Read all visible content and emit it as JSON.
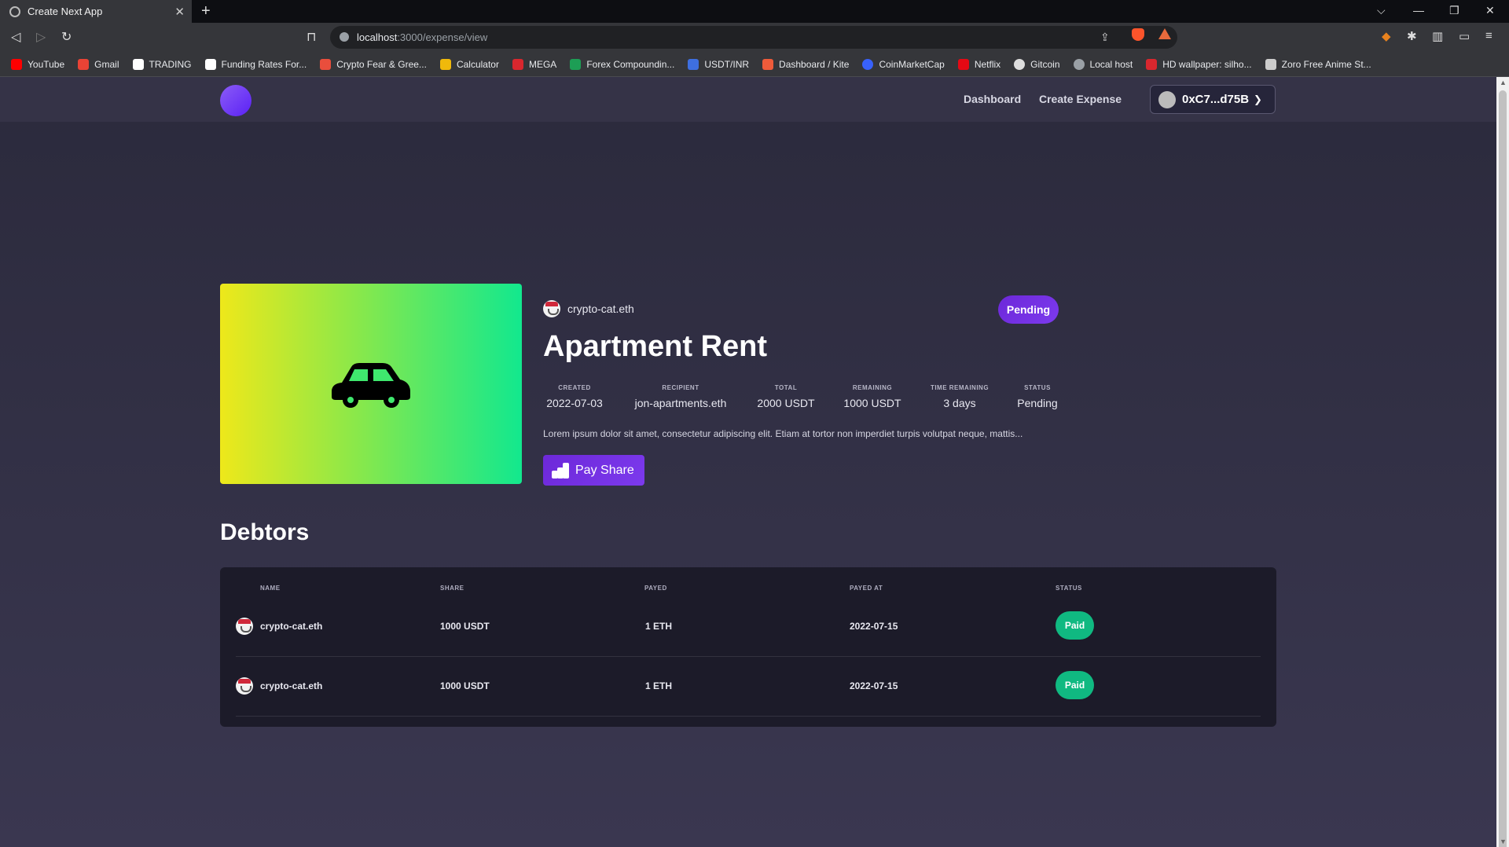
{
  "browser": {
    "tab_title": "Create Next App",
    "new_tab": "+",
    "url_host": "localhost",
    "url_path": ":3000/expense/view",
    "bookmarks": [
      {
        "label": "YouTube",
        "color": "#ff0000"
      },
      {
        "label": "Gmail",
        "color": "#ea4335"
      },
      {
        "label": "TRADING",
        "color": "#ffffff"
      },
      {
        "label": "Funding Rates For...",
        "color": "#ffffff"
      },
      {
        "label": "Crypto Fear & Gree...",
        "color": "#e94e3c"
      },
      {
        "label": "Calculator",
        "color": "#f0b90b"
      },
      {
        "label": "MEGA",
        "color": "#d9272e"
      },
      {
        "label": "Forex Compoundin...",
        "color": "#1d9e55"
      },
      {
        "label": "USDT/INR",
        "color": "#3e6fe0"
      },
      {
        "label": "Dashboard / Kite",
        "color": "#ef5b3a"
      },
      {
        "label": "CoinMarketCap",
        "color": "#3861fb"
      },
      {
        "label": "Netflix",
        "color": "#e50914"
      },
      {
        "label": "Gitcoin",
        "color": "#dddddd"
      },
      {
        "label": "Local host",
        "color": "#9aa0a6"
      },
      {
        "label": "HD wallpaper: silho...",
        "color": "#d9272e"
      },
      {
        "label": "Zoro Free Anime St...",
        "color": "#cccccc"
      }
    ]
  },
  "nav": {
    "links": [
      "Dashboard",
      "Create Expense"
    ],
    "wallet": "0xC7...d75B"
  },
  "expense": {
    "owner": "crypto-cat.eth",
    "badge": "Pending",
    "title": "Apartment Rent",
    "stats": [
      {
        "label": "CREATED",
        "value": "2022-07-03"
      },
      {
        "label": "RECIPIENT",
        "value": "jon-apartments.eth"
      },
      {
        "label": "TOTAL",
        "value": "2000 USDT"
      },
      {
        "label": "REMAINING",
        "value": "1000 USDT"
      },
      {
        "label": "TIME REMAINING",
        "value": "3 days"
      },
      {
        "label": "STATUS",
        "value": "Pending"
      }
    ],
    "description": "Lorem ipsum dolor sit amet, consectetur adipiscing elit. Etiam at tortor non imperdiet turpis volutpat neque, mattis...",
    "pay_button": "Pay Share"
  },
  "debtors": {
    "heading": "Debtors",
    "columns": [
      "NAME",
      "SHARE",
      "PAYED",
      "PAYED AT",
      "STATUS"
    ],
    "rows": [
      {
        "name": "crypto-cat.eth",
        "share": "1000 USDT",
        "payed": "1 ETH",
        "payed_at": "2022-07-15",
        "status": "Paid"
      },
      {
        "name": "crypto-cat.eth",
        "share": "1000 USDT",
        "payed": "1 ETH",
        "payed_at": "2022-07-15",
        "status": "Paid"
      }
    ]
  }
}
